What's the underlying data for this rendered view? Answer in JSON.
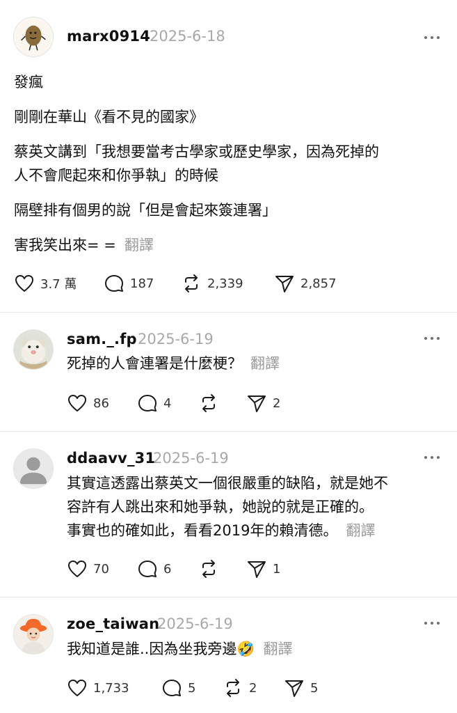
{
  "post": {
    "username": "marx0914",
    "date": "2025-6-18",
    "lines": [
      "發瘋",
      "剛剛在華山《看不見的國家》",
      "蔡英文講到「我想要當考古學家或歷史學家，因為死掉的",
      "人不會爬起來和你爭執」的時候",
      "隔壁排有個男的說「但是會起來簽連署」",
      "害我笑出來= ="
    ],
    "translate_label": "翻譯",
    "likes": "3.7 萬",
    "replies": "187",
    "reposts": "2,339",
    "shares": "2,857"
  },
  "replies": [
    {
      "username": "sam._.fp",
      "date": "2025-6-19",
      "lines": [
        "死掉的人會連署是什麼梗？"
      ],
      "translate_label": "翻譯",
      "likes": "86",
      "replies": "4",
      "reposts": "",
      "shares": "2"
    },
    {
      "username": "ddaavv_31",
      "date": "2025-6-19",
      "lines": [
        "其實這透露出蔡英文一個很嚴重的缺陷，就是她不",
        "容許有人跳出來和她爭執，她說的就是正確的。",
        "事實也的確如此，看看2019年的賴清德。"
      ],
      "translate_label": "翻譯",
      "likes": "70",
      "replies": "6",
      "reposts": "",
      "shares": "1"
    },
    {
      "username": "zoe_taiwan",
      "date": "2025-6-19",
      "lines": [
        "我知道是誰..因為坐我旁邊🤣"
      ],
      "translate_label": "翻譯",
      "likes": "1,733",
      "replies": "5",
      "reposts": "2",
      "shares": "5"
    }
  ],
  "icons": {
    "like": "heart-icon",
    "reply": "comment-bubble-icon",
    "repost": "repost-arrows-icon",
    "share": "send-paper-plane-icon",
    "more": "more-dots-icon"
  },
  "colors": {
    "text": "#101010",
    "muted": "#a8a8a8",
    "translate": "#9a9a9a",
    "divider": "#e6e6e6"
  }
}
